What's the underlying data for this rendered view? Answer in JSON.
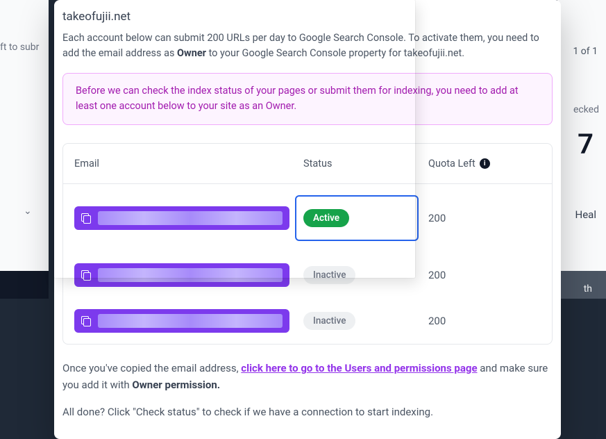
{
  "bg": {
    "left_text": "ft to subr",
    "right_top": "1 of 1",
    "right_mid": "ecked",
    "right_big": "7",
    "right_heal": "Heal",
    "right_th": "th",
    "chev": "⌄"
  },
  "header": {
    "domain": "takeofujii.net",
    "desc_pre": "Each account below can submit 200 URLs per day to Google Search Console. To activate them, you need to add the email address as ",
    "desc_bold": "Owner",
    "desc_post": " to your Google Search Console property for takeofujii.net."
  },
  "notice": "Before we can check the index status of your pages or submit them for indexing, you need to add at least one account below to your site as an Owner.",
  "table": {
    "col_email": "Email",
    "col_status": "Status",
    "col_quota": "Quota Left",
    "rows": [
      {
        "status": "Active",
        "status_class": "active",
        "quota": "200",
        "highlighted": true
      },
      {
        "status": "Inactive",
        "status_class": "inactive",
        "quota": "200",
        "highlighted": false
      },
      {
        "status": "Inactive",
        "status_class": "inactive",
        "quota": "200",
        "highlighted": false
      }
    ]
  },
  "instructions": {
    "pre": "Once you've copied the email address, ",
    "link": "click here to go to the Users and permissions page",
    "mid": " and make sure you add it with ",
    "bold": "Owner permission."
  },
  "followup": "All done? Click \"Check status\" to check if we have a connection to start indexing."
}
